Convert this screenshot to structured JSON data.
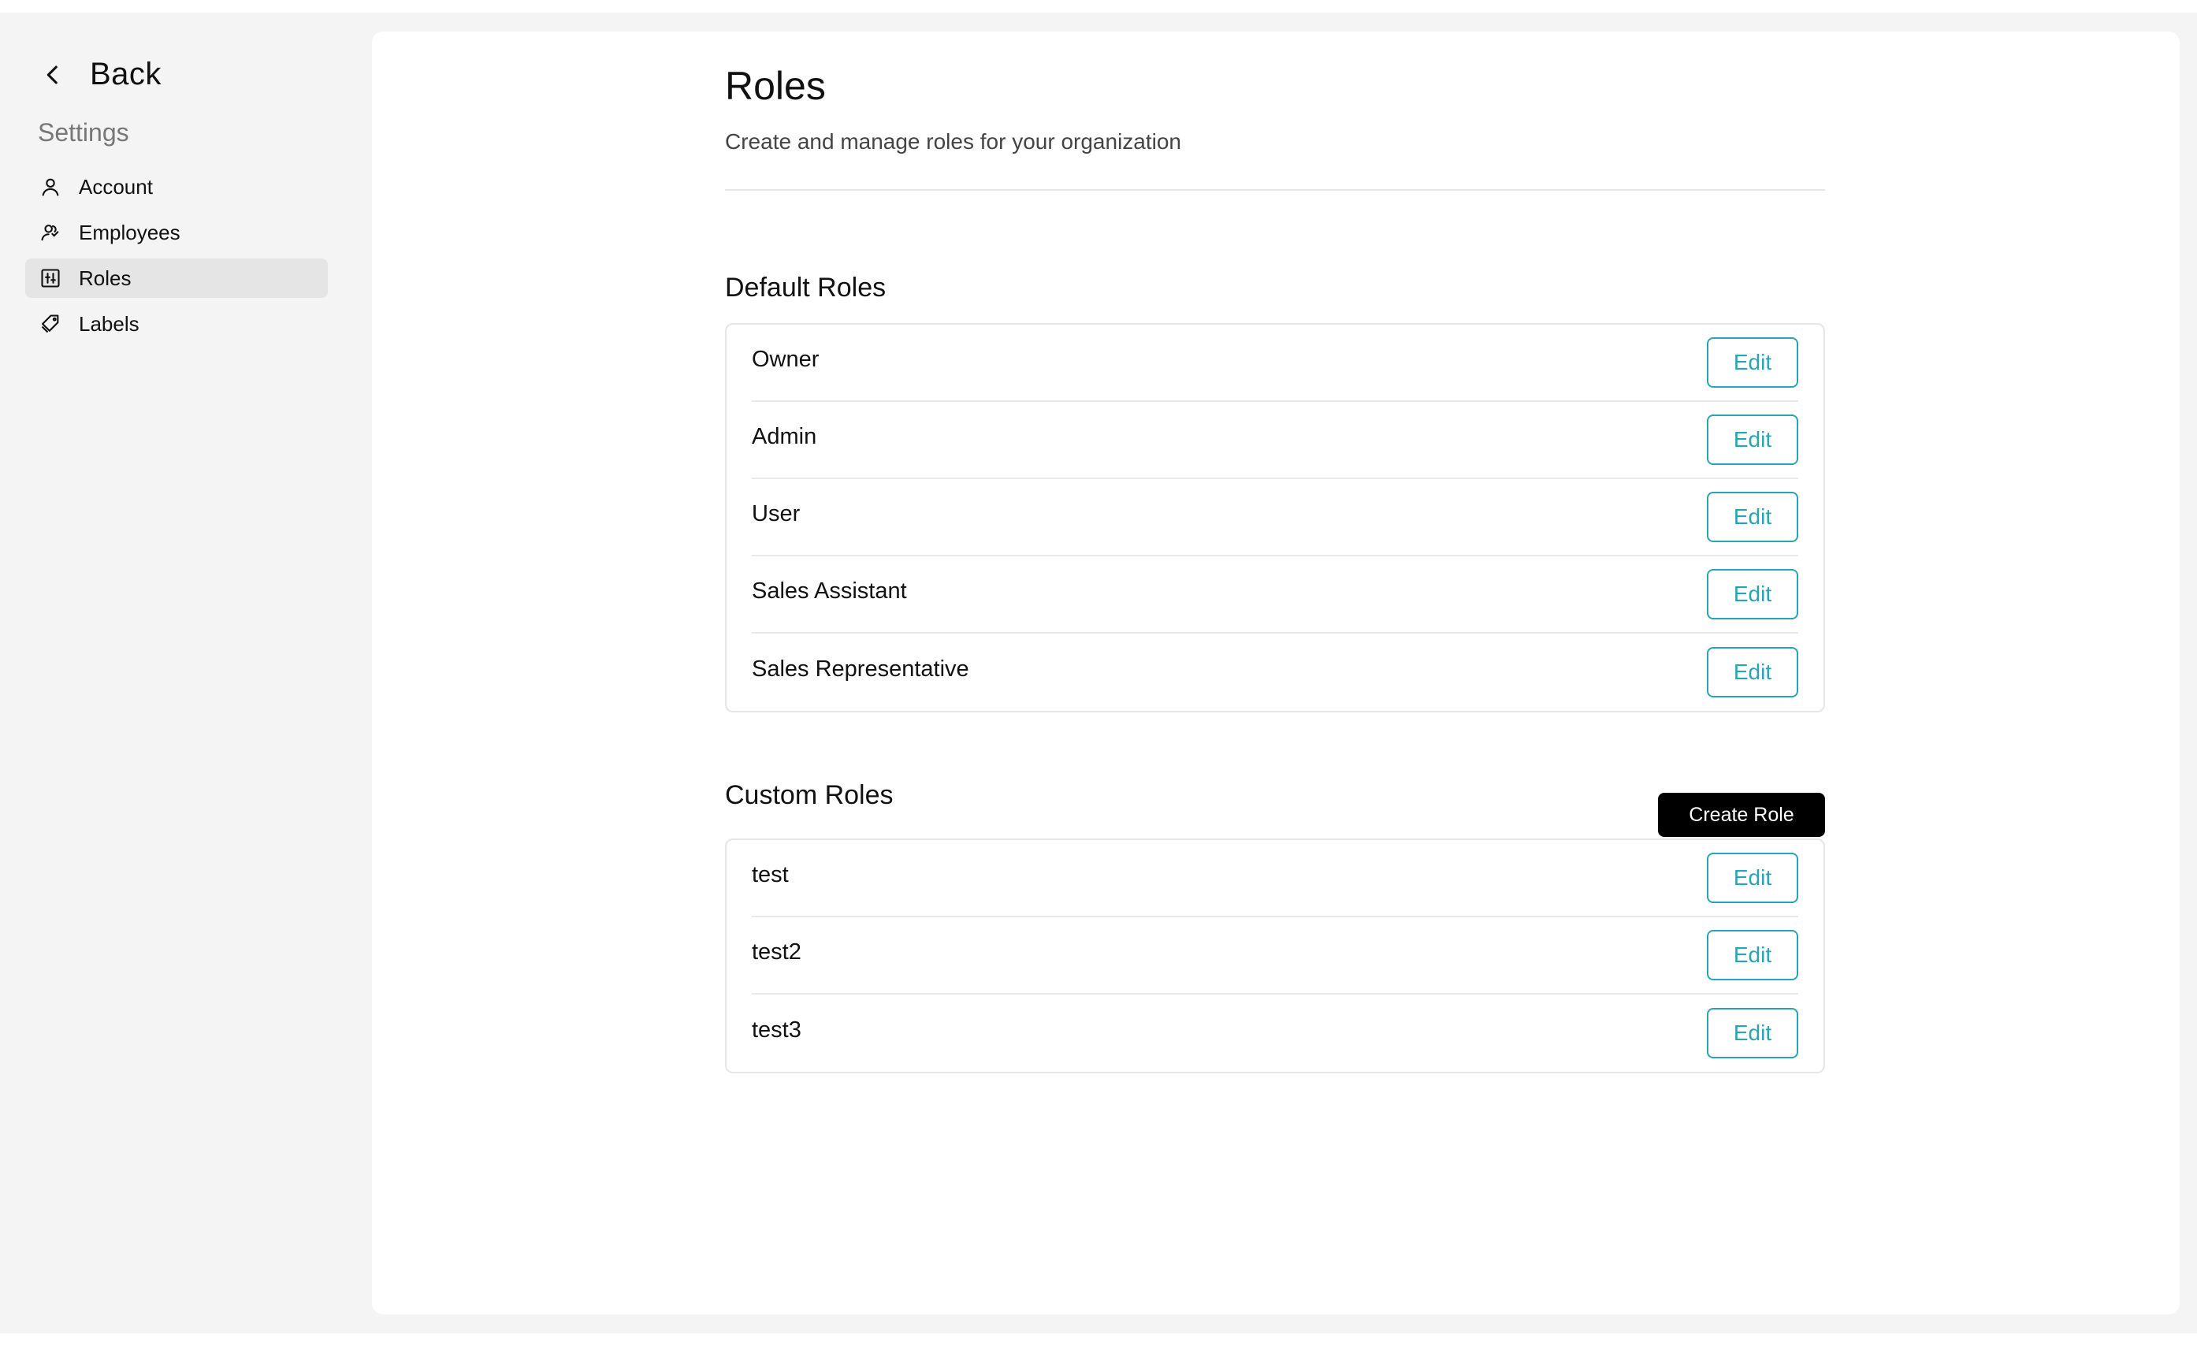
{
  "sidebar": {
    "back_label": "Back",
    "heading": "Settings",
    "items": [
      {
        "label": "Account",
        "icon": "user-icon",
        "active": false
      },
      {
        "label": "Employees",
        "icon": "users-icon",
        "active": false
      },
      {
        "label": "Roles",
        "icon": "roles-icon",
        "active": true
      },
      {
        "label": "Labels",
        "icon": "tag-icon",
        "active": false
      }
    ]
  },
  "page": {
    "title": "Roles",
    "subtitle": "Create and manage roles for your organization"
  },
  "default_roles": {
    "title": "Default Roles",
    "edit_label": "Edit",
    "roles": [
      "Owner",
      "Admin",
      "User",
      "Sales Assistant",
      "Sales Representative"
    ]
  },
  "custom_roles": {
    "title": "Custom Roles",
    "create_label": "Create Role",
    "edit_label": "Edit",
    "roles": [
      "test",
      "test2",
      "test3"
    ]
  },
  "colors": {
    "accent": "#2aa3b5",
    "primary_button": "#000000",
    "active_nav": "#e5e5e5",
    "sidebar_bg": "#f4f4f4"
  }
}
